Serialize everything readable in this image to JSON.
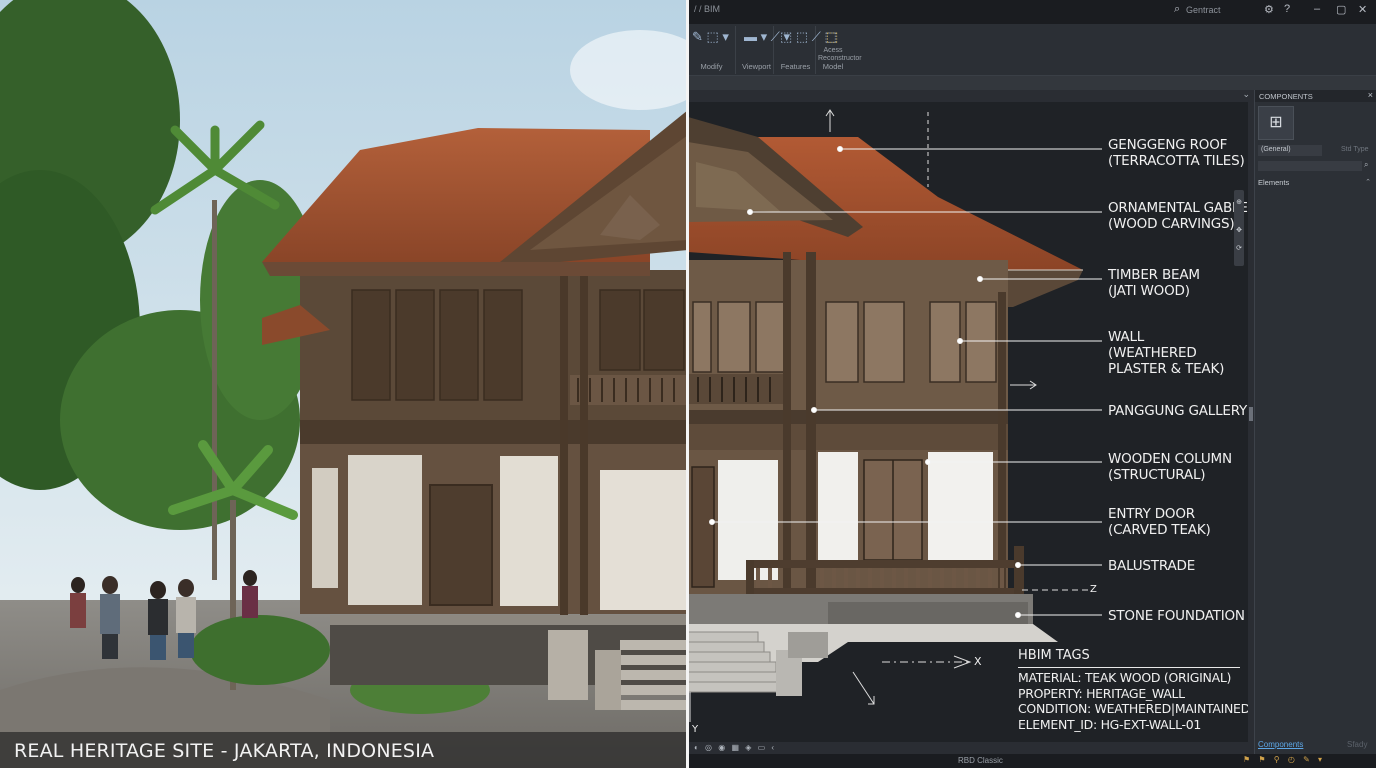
{
  "photo": {
    "caption": "REAL HERITAGE SITE - JAKARTA, INDONESIA"
  },
  "app": {
    "titlebar": {
      "document": "/ / BIM",
      "search_text": "Gentract",
      "icons": [
        "search-icon",
        "settings-icon",
        "help-icon",
        "minimize-icon",
        "restore-icon",
        "close-icon"
      ]
    },
    "ribbon": {
      "groups": [
        {
          "label": "Modify",
          "icons": "✎ ⬚ ▾"
        },
        {
          "label": "Viewport",
          "icons": "▬ ▾ ⟋ ▾"
        },
        {
          "label": "Features",
          "icons": "⬚ ⬚ ⟋ ⬚"
        },
        {
          "label": "Model",
          "icons": "⬚",
          "sub": "Acess Reconstructor"
        }
      ]
    },
    "callouts": [
      {
        "line1": "GENGGENG ROOF",
        "line2": "(TERRACOTTA TILES)",
        "line3": ""
      },
      {
        "line1": "ORNAMENTAL GABLE",
        "line2": "(WOOD CARVINGS)",
        "line3": ""
      },
      {
        "line1": "TIMBER BEAM",
        "line2": "(JATI WOOD)",
        "line3": ""
      },
      {
        "line1": "WALL",
        "line2": "(WEATHERED",
        "line3": "PLASTER & TEAK)"
      },
      {
        "line1": "PANGGUNG GALLERY",
        "line2": "",
        "line3": ""
      },
      {
        "line1": "WOODEN COLUMN",
        "line2": "(STRUCTURAL)",
        "line3": ""
      },
      {
        "line1": "ENTRY DOOR",
        "line2": "(CARVED TEAK)",
        "line3": ""
      },
      {
        "line1": "BALUSTRADE",
        "line2": "",
        "line3": ""
      },
      {
        "line1": "STONE FOUNDATION",
        "line2": "",
        "line3": ""
      }
    ],
    "axes": {
      "x": "X",
      "y": "Y",
      "z": "Z"
    },
    "hbim_tags": {
      "title": "HBIM TAGS",
      "lines": [
        "MATERIAL: TEAK WOOD (ORIGINAL)",
        "PROPERTY: HERITAGE_WALL",
        "CONDITION: WEATHERED|MAINTAINED",
        "ELEMENT_ID: HG-EXT-WALL-01"
      ]
    },
    "statusbar": {
      "model": "RBD Classic"
    },
    "panel": {
      "title": "COMPONENTS",
      "dropdown": "(General)",
      "dropdown2": "Std Type",
      "elements_label": "Elements",
      "footer_link": "Components",
      "footer_right": "Sfady"
    }
  },
  "colors": {
    "roof": "#a4542f",
    "wood": "#5a4634",
    "plaster": "#e6e2da",
    "sky": "#dce8ef",
    "foliage": "#3d6a2c",
    "accent": "#5da6e6"
  }
}
